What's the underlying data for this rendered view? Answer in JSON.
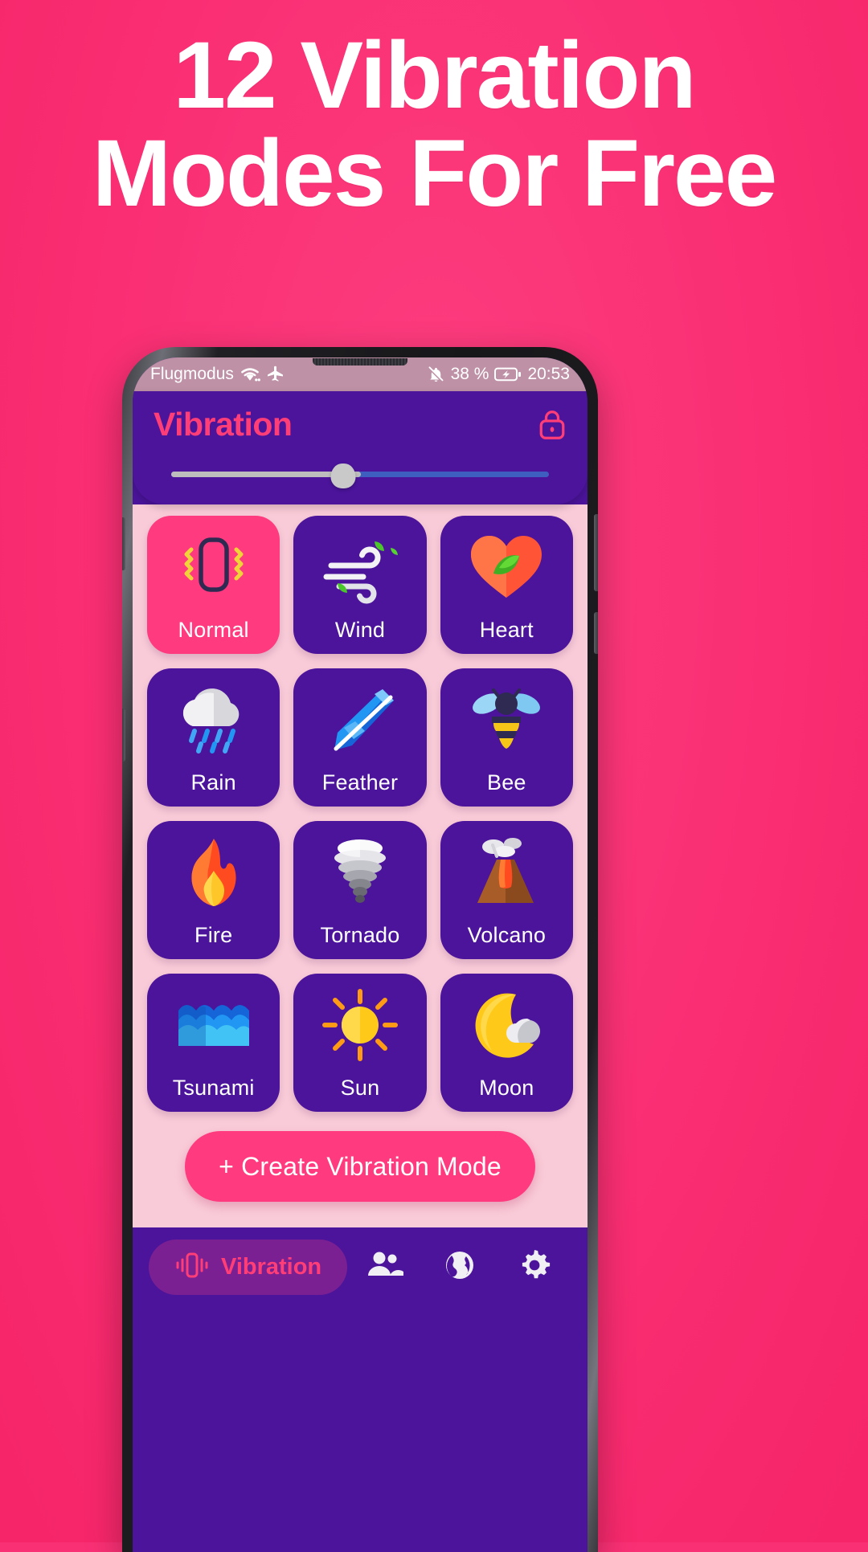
{
  "promo": {
    "headline": "12 Vibration Modes For Free",
    "bg_color": "#FA3075",
    "headline_color": "#FFFFFF"
  },
  "statusbar": {
    "carrier": "Flugmodus",
    "wifi_icon": "wifi-icon",
    "airplane_icon": "airplane-mode-icon",
    "bell_off_icon": "bell-off-icon",
    "battery_percent": "38 %",
    "battery_icon": "battery-charging-icon",
    "time": "20:53"
  },
  "header": {
    "title": "Vibration",
    "title_color": "#FF3D77",
    "lock_icon": "lock-icon",
    "slider": {
      "name": "intensity-slider",
      "value": 46,
      "min": 0,
      "max": 100
    }
  },
  "modes": [
    {
      "label": "Normal",
      "icon": "phone-vibrate-icon",
      "active": true
    },
    {
      "label": "Wind",
      "icon": "wind-icon",
      "active": false
    },
    {
      "label": "Heart",
      "icon": "heart-leaf-icon",
      "active": false
    },
    {
      "label": "Rain",
      "icon": "rain-cloud-icon",
      "active": false
    },
    {
      "label": "Feather",
      "icon": "feather-icon",
      "active": false
    },
    {
      "label": "Bee",
      "icon": "bee-icon",
      "active": false
    },
    {
      "label": "Fire",
      "icon": "fire-icon",
      "active": false
    },
    {
      "label": "Tornado",
      "icon": "tornado-icon",
      "active": false
    },
    {
      "label": "Volcano",
      "icon": "volcano-icon",
      "active": false
    },
    {
      "label": "Tsunami",
      "icon": "tsunami-icon",
      "active": false
    },
    {
      "label": "Sun",
      "icon": "sun-icon",
      "active": false
    },
    {
      "label": "Moon",
      "icon": "moon-icon",
      "active": false
    }
  ],
  "create_button": {
    "label": "+ Create Vibration Mode",
    "color": "#FF3A7E"
  },
  "nav": {
    "items": [
      {
        "label": "Vibration",
        "icon": "vibration-icon",
        "active": true
      },
      {
        "label": "",
        "icon": "people-icon",
        "active": false
      },
      {
        "label": "",
        "icon": "globe-icon",
        "active": false
      },
      {
        "label": "",
        "icon": "gear-icon",
        "active": false
      }
    ],
    "active_color": "#FF3D77",
    "pill_color": "#7A2092"
  },
  "colors": {
    "purple": "#4B149B",
    "pink": "#FF3A7E",
    "body_pink": "#F9CBD8",
    "status_bar": "#BE91A6"
  }
}
